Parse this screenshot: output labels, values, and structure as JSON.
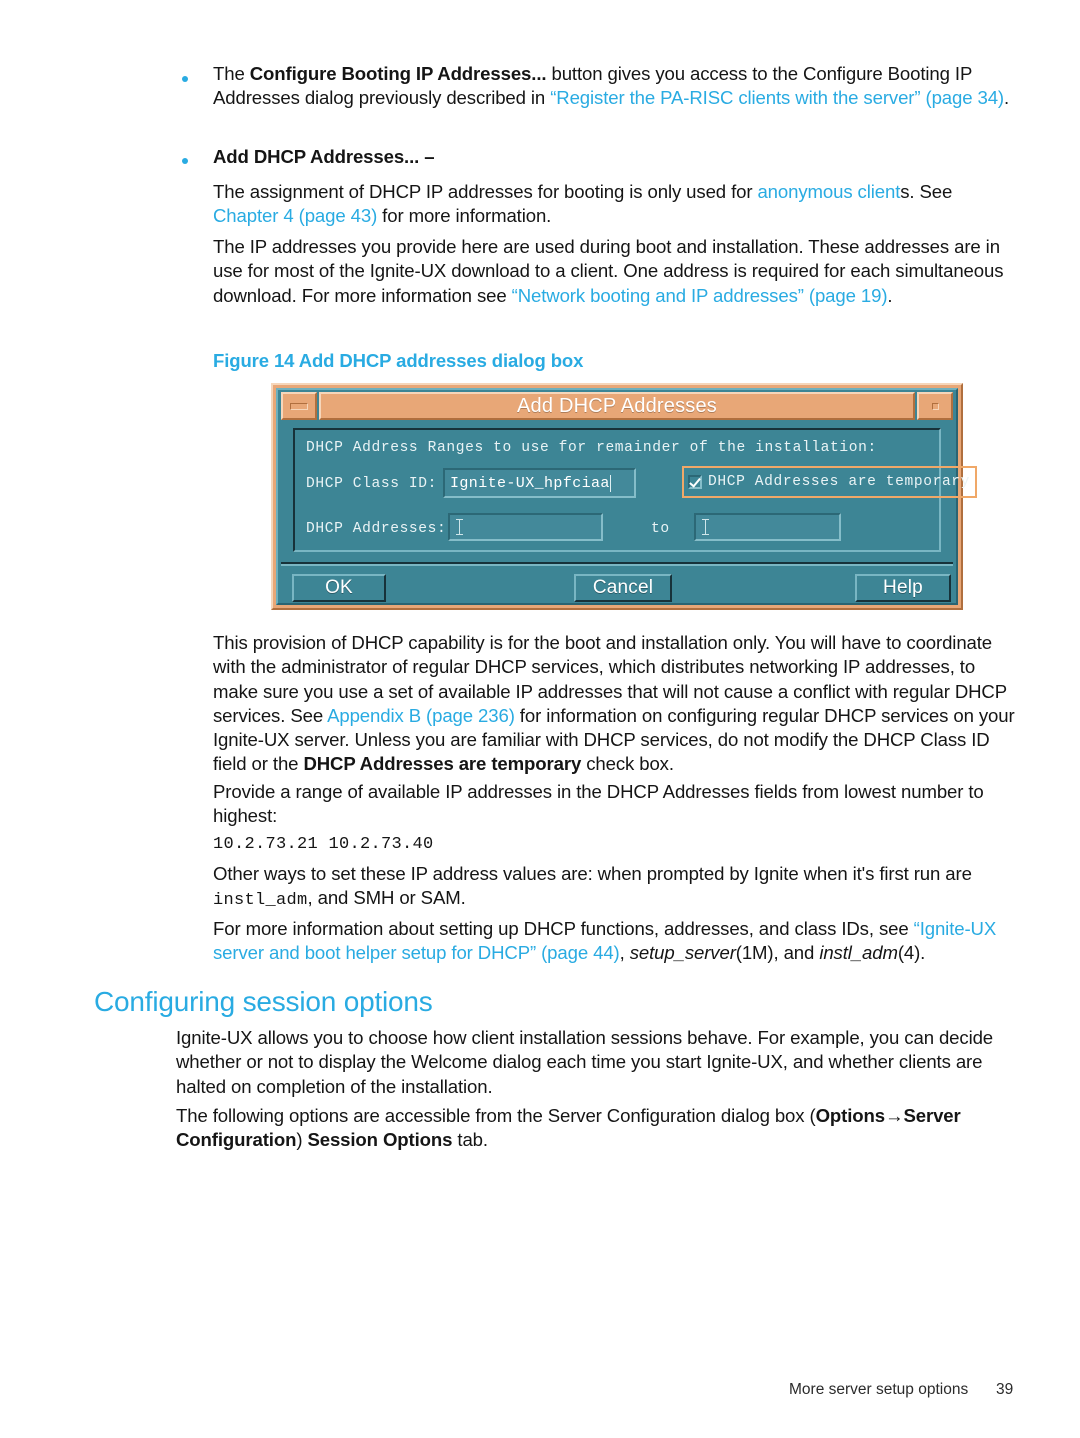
{
  "page": {
    "number": "39",
    "footer_text": "More server setup options"
  },
  "bullets": [
    {
      "id": "configure-booting-ip",
      "segments": [
        {
          "t": "The ",
          "style": "normal"
        },
        {
          "t": "Configure Booting IP Addresses...",
          "style": "bold"
        },
        {
          "t": " button gives you access to the Configure Booting IP Addresses dialog previously described in ",
          "style": "normal"
        },
        {
          "t": "“Register the PA-RISC clients with the server” (page 34)",
          "style": "link"
        },
        {
          "t": ".",
          "style": "normal"
        }
      ]
    },
    {
      "id": "add-dhcp-addresses",
      "label": "Add DHCP Addresses... –"
    }
  ],
  "paragraphs": {
    "anonymous_clients": [
      {
        "t": "The assignment of DHCP IP addresses for booting is only used for ",
        "style": "normal"
      },
      {
        "t": "anonymous client",
        "style": "link"
      },
      {
        "t": "s. See ",
        "style": "normal"
      },
      {
        "t": "Chapter 4 (page 43)",
        "style": "link"
      },
      {
        "t": " for more information.",
        "style": "normal"
      }
    ],
    "ip_addresses_boot": [
      {
        "t": "The IP addresses you provide here are used during boot and installation. These addresses are in use for most of the Ignite-UX download to a client. One address is required for each simultaneous download. For more information see ",
        "style": "normal"
      },
      {
        "t": "“Network booting and IP addresses” (page 19)",
        "style": "link"
      },
      {
        "t": ".",
        "style": "normal"
      }
    ],
    "dhcp_provision": [
      {
        "t": "This provision of DHCP capability is for the boot and installation only. You will have to coordinate with the administrator of regular DHCP services, which distributes networking IP addresses, to make sure you use a set of available IP addresses that will not cause a conflict with regular DHCP services. See ",
        "style": "normal"
      },
      {
        "t": "Appendix B (page 236)",
        "style": "link"
      },
      {
        "t": " for information on configuring regular DHCP services on your Ignite-UX server. Unless you are familiar with DHCP services, do not modify the DHCP Class ID field or the ",
        "style": "normal"
      },
      {
        "t": "DHCP Addresses are temporary",
        "style": "bold"
      },
      {
        "t": " check box.",
        "style": "normal"
      }
    ],
    "provide_range": [
      {
        "t": "Provide a range of available IP addresses in the DHCP Addresses fields from lowest number to highest:",
        "style": "normal"
      }
    ],
    "ip_example": "10.2.73.21        10.2.73.40",
    "other_ways": [
      {
        "t": "Other ways to set these IP address values are: when prompted by Ignite when it's first run are ",
        "style": "normal"
      },
      {
        "t": "instl_adm",
        "style": "mono"
      },
      {
        "t": ", and SMH or SAM.",
        "style": "normal"
      }
    ],
    "more_info_dhcp": [
      {
        "t": "For more information about setting up DHCP functions, addresses, and class IDs, see ",
        "style": "normal"
      },
      {
        "t": "“Ignite-UX server and boot helper setup for DHCP” (page 44)",
        "style": "link"
      },
      {
        "t": ", ",
        "style": "normal"
      },
      {
        "t": "setup_server",
        "style": "italic"
      },
      {
        "t": "(1M), and ",
        "style": "normal"
      },
      {
        "t": "instl_adm",
        "style": "italic"
      },
      {
        "t": "(4).",
        "style": "normal"
      }
    ],
    "session_intro": [
      {
        "t": "Ignite-UX allows you to choose how client installation sessions behave. For example, you can decide whether or not to display the Welcome dialog each time you start Ignite-UX, and whether clients are halted on completion of the installation.",
        "style": "normal"
      }
    ],
    "session_options_access": [
      {
        "t": "The following options are accessible from the Server Configuration dialog box (",
        "style": "normal"
      },
      {
        "t": "Options→Server Configuration",
        "style": "bold"
      },
      {
        "t": ") ",
        "style": "normal"
      },
      {
        "t": "Session Options",
        "style": "bold"
      },
      {
        "t": " tab.",
        "style": "normal"
      }
    ]
  },
  "figure": {
    "caption": "Figure 14 Add DHCP addresses dialog box"
  },
  "section": {
    "heading": "Configuring session options"
  },
  "dialog": {
    "title": "Add DHCP Addresses",
    "minimize_icon": "minimize-icon",
    "maximize_icon": "maximize-icon",
    "group_header": "DHCP Address Ranges to use for remainder of the installation:",
    "class_id_label": "DHCP Class ID:",
    "class_id_value": "Ignite-UX_hpfciaa",
    "temporary_checkbox_label": "DHCP Addresses are temporary",
    "temporary_checkbox_checked": true,
    "addresses_label": "DHCP Addresses:",
    "addresses_from_value": "",
    "addresses_to_label": "to",
    "addresses_to_value": "",
    "buttons": {
      "ok": "OK",
      "cancel": "Cancel",
      "help": "Help"
    },
    "colors": {
      "frame": "#e8a777",
      "body": "#3d8595",
      "field": "#43899a",
      "focus_outline": "#f0a868",
      "title_text": "#ffffff"
    }
  },
  "colors": {
    "link": "#29ABE2",
    "body_text": "#151515",
    "background": "#ffffff"
  }
}
